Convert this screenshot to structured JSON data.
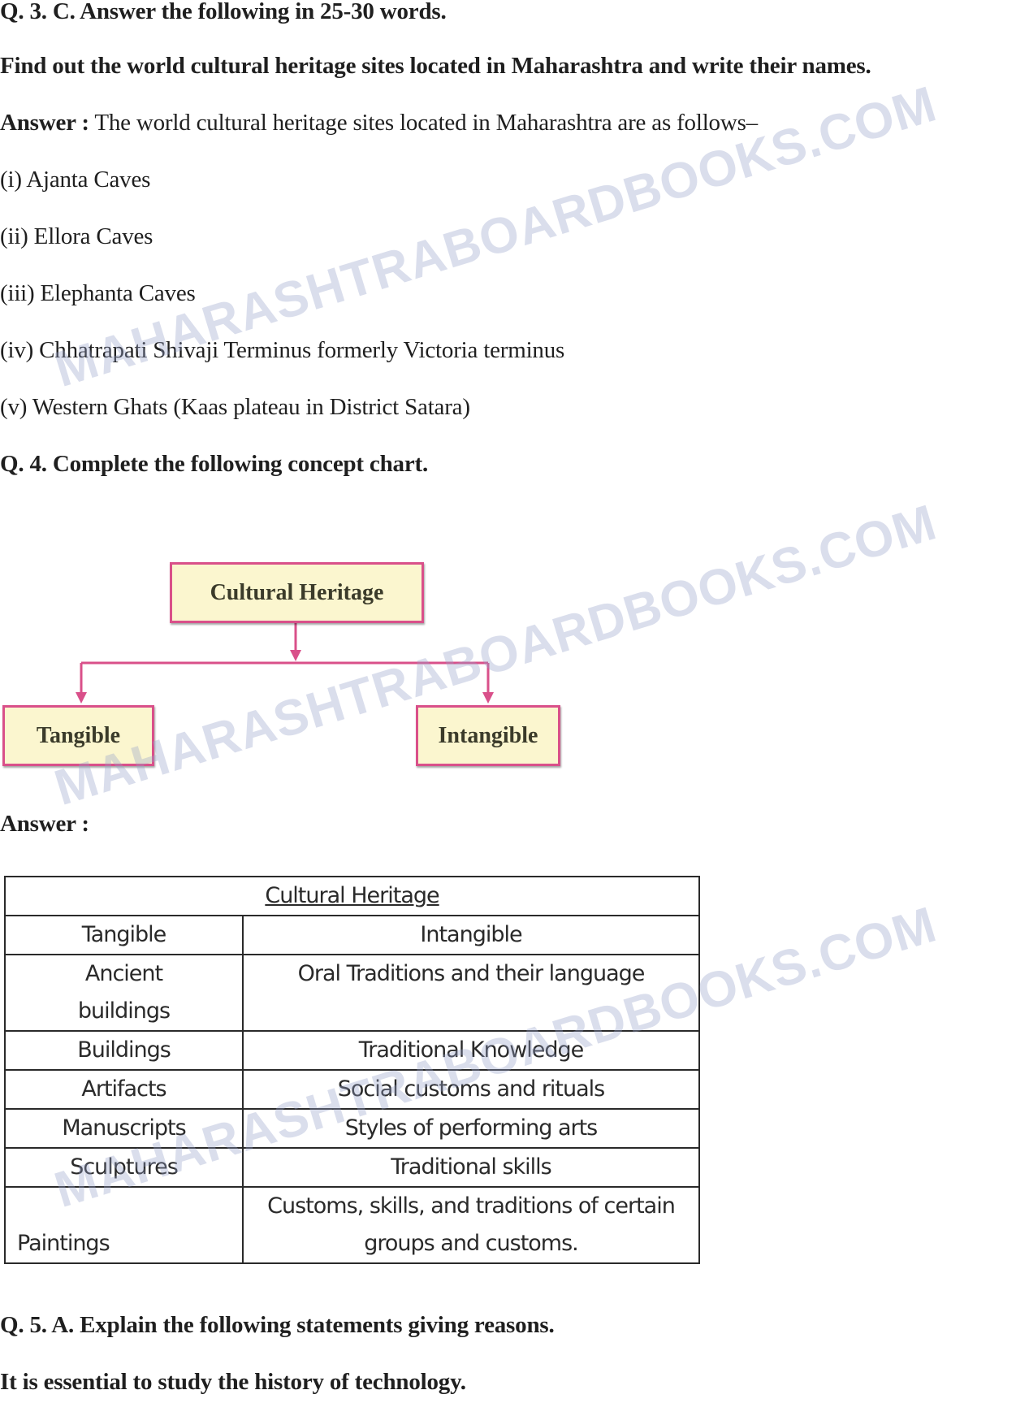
{
  "q3c": {
    "heading": "Q. 3. C. Answer the following in 25-30 words.",
    "question": "Find out the world cultural heritage sites located in Maharashtra and write their names.",
    "answer_label": "Answer :",
    "answer_text": " The world cultural heritage sites located in Maharashtra are as follows–",
    "sites": [
      "(i) Ajanta Caves",
      "(ii) Ellora Caves",
      "(iii) Elephanta Caves",
      "(iv) Chhatrapati Shivaji Terminus formerly Victoria terminus",
      "(v) Western Ghats (Kaas plateau in District Satara)"
    ]
  },
  "q4": {
    "heading": "Q. 4. Complete the following concept chart.",
    "chart": {
      "root": "Cultural Heritage",
      "left": "Tangible",
      "right": "Intangible",
      "box_fill": "#fbf6cf",
      "line_color": "#d9508a"
    },
    "answer_label": "Answer :",
    "table": {
      "title": "Cultural Heritage",
      "headers": [
        "Tangible",
        "Intangible"
      ],
      "rows": [
        [
          "Ancient buildings",
          "Oral Traditions and their language"
        ],
        [
          "Buildings",
          "Traditional Knowledge"
        ],
        [
          "Artifacts",
          "Social customs and rituals"
        ],
        [
          "Manuscripts",
          "Styles of performing arts"
        ],
        [
          "Sculptures",
          "Traditional skills"
        ],
        [
          "Paintings",
          "Customs, skills, and traditions of certain groups and customs."
        ]
      ]
    }
  },
  "q5a": {
    "heading": "Q. 5. A. Explain the following statements giving reasons.",
    "statement": "It is essential to study the history of technology."
  },
  "watermark": "MAHARASHTRABOARDBOOKS.COM"
}
